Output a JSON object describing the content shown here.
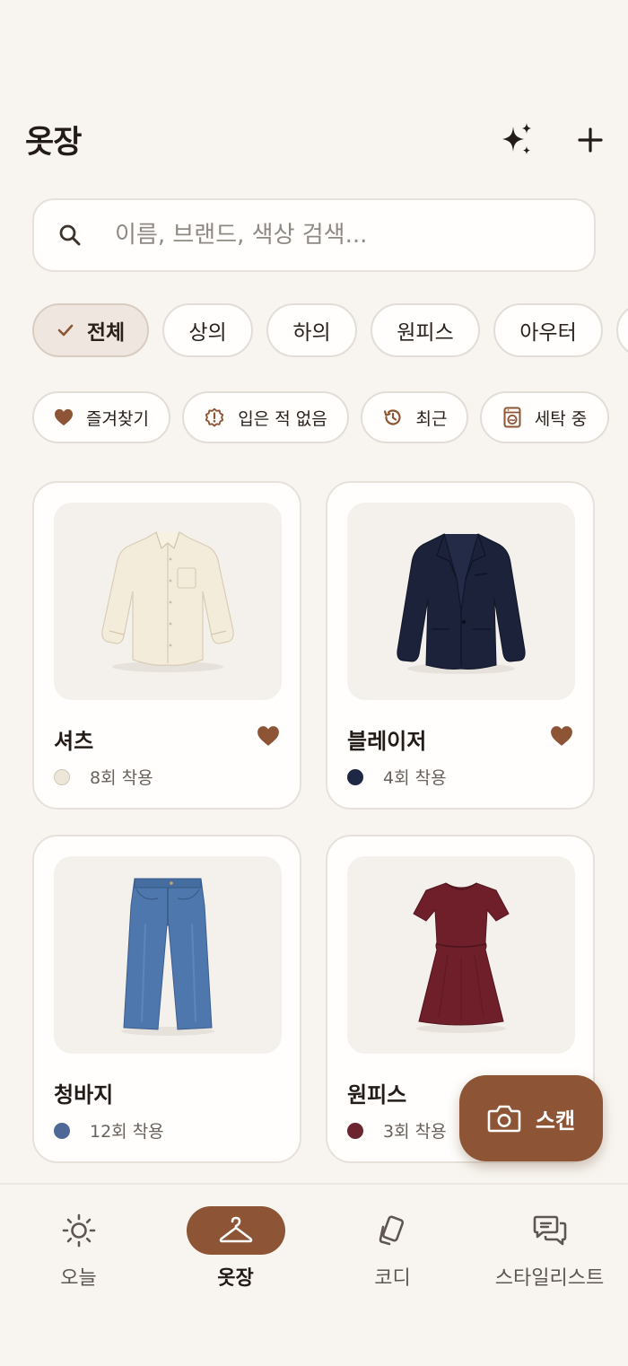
{
  "header": {
    "title": "옷장",
    "sparkle_icon": "sparkles-icon",
    "add_icon": "plus-icon"
  },
  "search": {
    "placeholder": "이름, 브랜드, 색상 검색...",
    "value": ""
  },
  "categories": [
    {
      "label": "전체",
      "selected": true
    },
    {
      "label": "상의",
      "selected": false
    },
    {
      "label": "하의",
      "selected": false
    },
    {
      "label": "원피스",
      "selected": false
    },
    {
      "label": "아우터",
      "selected": false
    }
  ],
  "filters": [
    {
      "label": "즐겨찾기",
      "icon": "heart-icon"
    },
    {
      "label": "입은 적 없음",
      "icon": "alert-badge-icon"
    },
    {
      "label": "최근",
      "icon": "history-icon"
    },
    {
      "label": "세탁 중",
      "icon": "washing-machine-icon"
    }
  ],
  "items": [
    {
      "name": "셔츠",
      "wear": "8회 착용",
      "color": "#ece7d8",
      "favorite": true,
      "image": "cream-shirt"
    },
    {
      "name": "블레이저",
      "wear": "4회 착용",
      "color": "#1e2744",
      "favorite": true,
      "image": "navy-blazer"
    },
    {
      "name": "청바지",
      "wear": "12회 착용",
      "color": "#4f6898",
      "favorite": false,
      "image": "blue-jeans"
    },
    {
      "name": "원피스",
      "wear": "3회 착용",
      "color": "#6b2430",
      "favorite": false,
      "image": "burgundy-dress"
    }
  ],
  "fab": {
    "label": "스캔",
    "icon": "camera-icon"
  },
  "nav": [
    {
      "label": "오늘",
      "icon": "sun-icon",
      "active": false
    },
    {
      "label": "옷장",
      "icon": "hanger-icon",
      "active": true
    },
    {
      "label": "코디",
      "icon": "cards-icon",
      "active": false
    },
    {
      "label": "스타일리스트",
      "icon": "chat-bubbles-icon",
      "active": false
    }
  ],
  "colors": {
    "accent": "#8d5535",
    "heart": "#8d5535",
    "background": "#f8f5f0"
  }
}
